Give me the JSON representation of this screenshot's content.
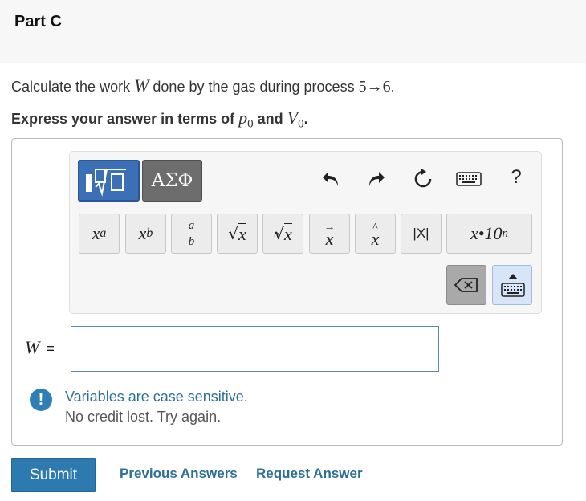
{
  "part": {
    "title": "Part C"
  },
  "question": {
    "prompt_before": "Calculate the work ",
    "prompt_var": "W",
    "prompt_after_1": " done by the gas during process ",
    "prompt_process": "5→6",
    "prompt_end": ".",
    "instruction_before": "Express your answer in terms of ",
    "instruction_var1": "p",
    "instruction_sub1": "0",
    "instruction_and": " and ",
    "instruction_var2": "V",
    "instruction_sub2": "0",
    "instruction_end": "."
  },
  "toolbar": {
    "tab_templates_icon": "templates-icon",
    "tab_greek_label": "ΑΣΦ",
    "undo_icon": "undo-icon",
    "redo_icon": "redo-icon",
    "reset_icon": "reset-icon",
    "keyboard_icon": "keyboard-icon",
    "help_label": "?",
    "buttons": {
      "superscript": {
        "base": "x",
        "exp": "a"
      },
      "subscript": {
        "base": "x",
        "sub": "b"
      },
      "fraction": {
        "num": "a",
        "den": "b"
      },
      "sqrt": {
        "label": "x"
      },
      "nthroot": {
        "index": "n",
        "label": "x"
      },
      "vector": {
        "label": "x"
      },
      "hat": {
        "label": "x"
      },
      "abs": {
        "label": "|X|"
      },
      "scientific": {
        "base": "x•10",
        "exp": "n"
      }
    },
    "delete_icon": "backspace-icon",
    "keyboard_toggle_icon": "keyboard-toggle-icon"
  },
  "answer": {
    "label": "W",
    "equals": "=",
    "value": ""
  },
  "feedback": {
    "icon": "!",
    "line1": "Variables are case sensitive.",
    "line2": "No credit lost. Try again."
  },
  "actions": {
    "submit_label": "Submit",
    "previous_answers_label": "Previous Answers",
    "request_answer_label": "Request Answer"
  },
  "colors": {
    "accent": "#2c7ab0",
    "template_tab": "#3b6fb6",
    "greek_tab": "#6d6d6d",
    "feedback_text": "#2e6f96"
  }
}
